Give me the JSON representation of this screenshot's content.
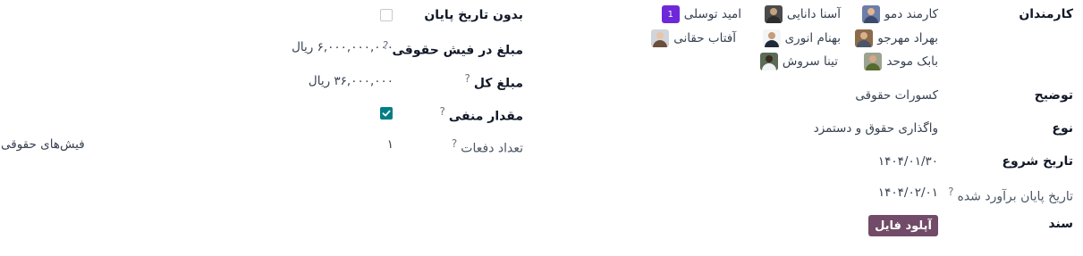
{
  "left_column": {
    "employees_label": "کارمندان",
    "employees": [
      {
        "name": "کارمند دمو",
        "avatar": "photo-man-beard"
      },
      {
        "name": "آسنا دانایی",
        "avatar": "photo-man-dark"
      },
      {
        "name": "امید توسلی",
        "avatar": "initial",
        "initial": "1"
      },
      {
        "name": "بهراد مهرجو",
        "avatar": "photo-man-glasses"
      },
      {
        "name": "بهنام انوری",
        "avatar": "photo-man-suit"
      },
      {
        "name": "آفتاب حقانی",
        "avatar": "photo-woman"
      },
      {
        "name": "بابک موحد",
        "avatar": "photo-man-casual"
      },
      {
        "name": "تینا سروش",
        "avatar": "photo-woman-dark"
      }
    ],
    "description_label": "توضیح",
    "description_value": "کسورات حقوقی",
    "type_label": "نوع",
    "type_value": "واگذاری حقوق و دستمزد",
    "start_date_label": "تاریخ شروع",
    "start_date_value": "۱۴۰۴/۰۱/۳۰",
    "estimated_end_label": "تاریخ پایان برآورد شده",
    "estimated_end_help": "?",
    "estimated_end_value": "۱۴۰۴/۰۲/۰۱",
    "document_label": "سند",
    "upload_button": "آپلود فایل"
  },
  "right_column": {
    "no_end_date_label": "بدون تاریخ پایان",
    "no_end_date_checked": false,
    "payslip_amount_label": "مبلغ در فیش حقوقی",
    "payslip_amount_help": "?",
    "payslip_amount_value": "۶,۰۰۰,۰۰۰,۰۰۰ ریال",
    "total_amount_label": "مبلغ کل",
    "total_amount_help": "?",
    "total_amount_value": "۳۶,۰۰۰,۰۰۰ ریال",
    "negative_amount_label": "مقدار منفی",
    "negative_amount_help": "?",
    "negative_amount_checked": true,
    "installments_label": "تعداد دفعات",
    "installments_help": "?",
    "installments_value": "۱"
  },
  "payslips_link": "فیش‌های حقوقی",
  "colors": {
    "accent_teal": "#017e84",
    "button_purple": "#714b67",
    "initial_avatar": "#6d28d9"
  }
}
